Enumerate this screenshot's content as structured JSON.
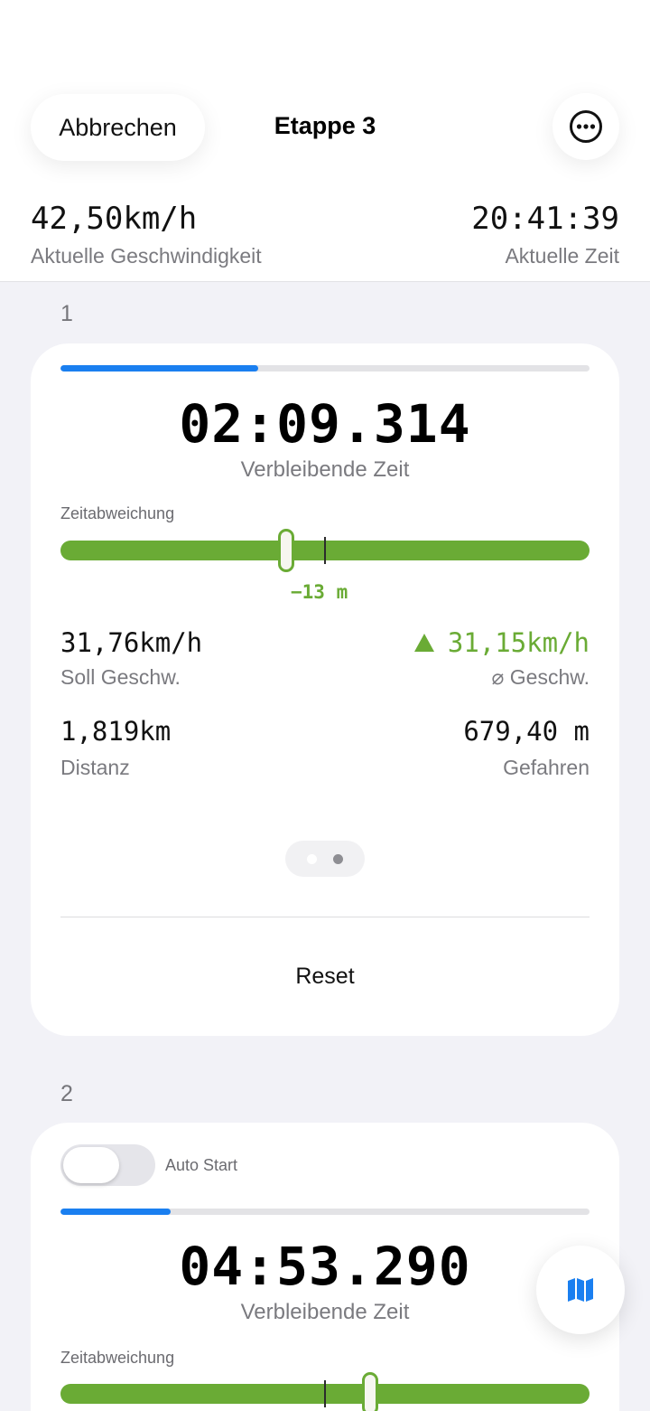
{
  "header": {
    "cancel_label": "Abbrechen",
    "title": "Etappe 3",
    "more_icon": "ellipsis-circle-icon",
    "current_speed_value": "42,50km/h",
    "current_speed_label": "Aktuelle Geschwindigkeit",
    "current_time_value": "20:41:39",
    "current_time_label": "Aktuelle Zeit"
  },
  "stages": [
    {
      "number": "1",
      "progress": 0.374,
      "remaining_time": "02:09.314",
      "remaining_label": "Verbleibende Zeit",
      "deviation_label": "Zeitabweichung",
      "deviation_value": "−13 m",
      "target_speed_value": "31,76km/h",
      "target_speed_label": "Soll Geschw.",
      "avg_speed_value": "31,15km/h",
      "avg_speed_label": "⌀ Geschw.",
      "distance_value": "1,819km",
      "distance_label": "Distanz",
      "driven_value": "679,40 m",
      "driven_label": "Gefahren",
      "pager_pages": 2,
      "pager_current": 2,
      "reset_label": "Reset"
    },
    {
      "number": "2",
      "auto_start_label": "Auto Start",
      "auto_start_on": false,
      "progress": 0.208,
      "remaining_time": "04:53.290",
      "remaining_label": "Verbleibende Zeit",
      "deviation_label": "Zeitabweichung"
    }
  ],
  "map_button_icon": "map-icon",
  "colors": {
    "accent_blue": "#1a7ff0",
    "deviation_green": "#6aab35",
    "background": "#f2f2f7"
  }
}
